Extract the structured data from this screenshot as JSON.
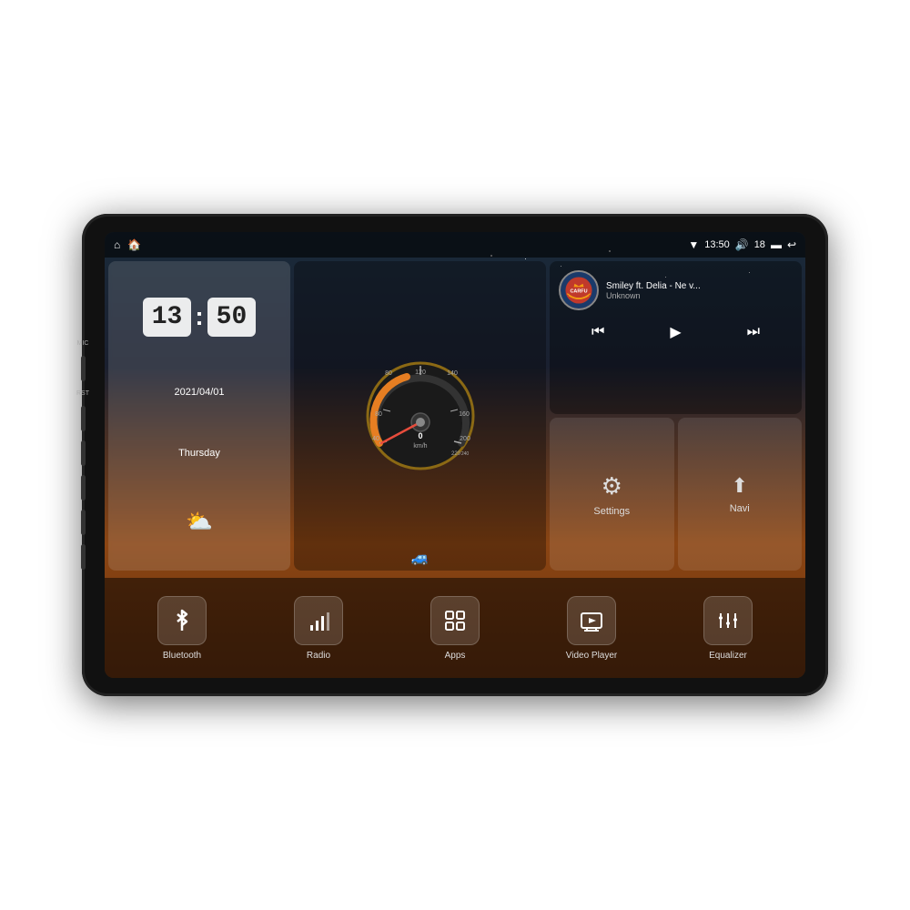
{
  "device": {
    "mic_label": "MIC",
    "rst_label": "RST"
  },
  "status_bar": {
    "wifi_icon": "▼",
    "time": "13:50",
    "volume_icon": "🔊",
    "volume_level": "18",
    "battery_icon": "🔋",
    "back_icon": "↩"
  },
  "clock": {
    "hour": "13",
    "minute": "50",
    "date": "2021/04/01",
    "day": "Thursday",
    "weather_icon": "⛅"
  },
  "music": {
    "song_title": "Smiley ft. Delia - Ne v...",
    "artist": "Unknown",
    "album_label": "CARFU",
    "prev_icon": "⏮",
    "play_icon": "▶",
    "next_icon": "⏭"
  },
  "settings_widget": {
    "icon": "⚙",
    "label": "Settings"
  },
  "navi_widget": {
    "icon": "⬆",
    "label": "Navi"
  },
  "bottom_bar": {
    "items": [
      {
        "key": "bluetooth",
        "icon": "ᛒ",
        "label": "Bluetooth"
      },
      {
        "key": "radio",
        "icon": "📶",
        "label": "Radio"
      },
      {
        "key": "apps",
        "icon": "⊞",
        "label": "Apps"
      },
      {
        "key": "video_player",
        "icon": "📺",
        "label": "Video Player"
      },
      {
        "key": "equalizer",
        "icon": "🎚",
        "label": "Equalizer"
      }
    ]
  }
}
